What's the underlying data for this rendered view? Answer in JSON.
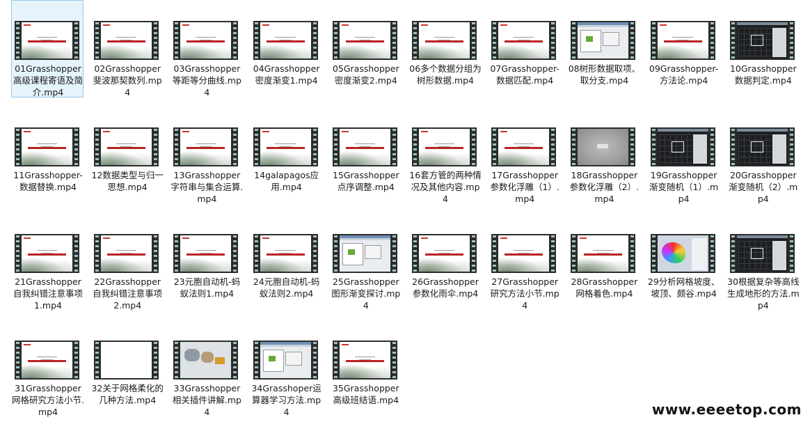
{
  "selected_index": 0,
  "watermark": "www.eeeetop.com",
  "files": [
    {
      "label": "01Grasshopper高级课程寄语及简介.mp4",
      "thumb": "slide"
    },
    {
      "label": "02Grasshopper斐波那契数列.mp4",
      "thumb": "slide"
    },
    {
      "label": "03Grasshopper等距等分曲线.mp4",
      "thumb": "slide"
    },
    {
      "label": "04Grasshopper密度渐变1.mp4",
      "thumb": "slide"
    },
    {
      "label": "05Grasshopper密度渐变2.mp4",
      "thumb": "slide"
    },
    {
      "label": "06多个数据分组为树形数据.mp4",
      "thumb": "slide"
    },
    {
      "label": "07Grasshopper-数据匹配.mp4",
      "thumb": "slide"
    },
    {
      "label": "08树形数据取项、取分支.mp4",
      "thumb": "sw"
    },
    {
      "label": "09Grasshopper-方法论.mp4",
      "thumb": "slide"
    },
    {
      "label": "10Grasshopper数据判定.mp4",
      "thumb": "dark"
    },
    {
      "label": "11Grasshopper-数据替换.mp4",
      "thumb": "slide"
    },
    {
      "label": "12数据类型与归一思想.mp4",
      "thumb": "slide"
    },
    {
      "label": "13Grasshopper字符串与集合运算.mp4",
      "thumb": "slide"
    },
    {
      "label": "14galapagos应用.mp4",
      "thumb": "slide"
    },
    {
      "label": "15Grasshopper点序调整.mp4",
      "thumb": "slide"
    },
    {
      "label": "16套方管的两种情况及其他内容.mp4",
      "thumb": "slide"
    },
    {
      "label": "17Grasshopper参数化浮雕（1）.mp4",
      "thumb": "slide"
    },
    {
      "label": "18Grasshopper参数化浮雕（2）.mp4",
      "thumb": "gray"
    },
    {
      "label": "19Grasshopper渐变随机（1）.mp4",
      "thumb": "dark"
    },
    {
      "label": "20Grasshopper渐变随机（2）.mp4",
      "thumb": "dark"
    },
    {
      "label": "21Grasshopper自我纠错注意事项1.mp4",
      "thumb": "slide"
    },
    {
      "label": "22Grasshopper自我纠错注意事项2.mp4",
      "thumb": "slide"
    },
    {
      "label": "23元胞自动机-蚂蚁法则1.mp4",
      "thumb": "slide"
    },
    {
      "label": "24元胞自动机-蚂蚁法则2.mp4",
      "thumb": "slide"
    },
    {
      "label": "25Grasshopper图形渐变探讨.mp4",
      "thumb": "sw"
    },
    {
      "label": "26Grasshopper参数化雨伞.mp4",
      "thumb": "slide"
    },
    {
      "label": "27Grasshopper研究方法小节.mp4",
      "thumb": "slide"
    },
    {
      "label": "28Grasshopper网格着色.mp4",
      "thumb": "slide"
    },
    {
      "label": "29分析网格坡度、坡顶、颇谷.mp4",
      "thumb": "mesh"
    },
    {
      "label": "30根据复杂等高线生成地形的方法.mp4",
      "thumb": "dark"
    },
    {
      "label": "31Grasshopper网格研究方法小节.mp4",
      "thumb": "slide"
    },
    {
      "label": "32关于网格柔化的几种方法.mp4",
      "thumb": "blank"
    },
    {
      "label": "33Grasshopper相关插件讲解.mp4",
      "thumb": "photo"
    },
    {
      "label": "34Grasshoper运算器学习方法.mp4",
      "thumb": "sw"
    },
    {
      "label": "35Grasshopper高级班结语.mp4",
      "thumb": "slide"
    }
  ]
}
